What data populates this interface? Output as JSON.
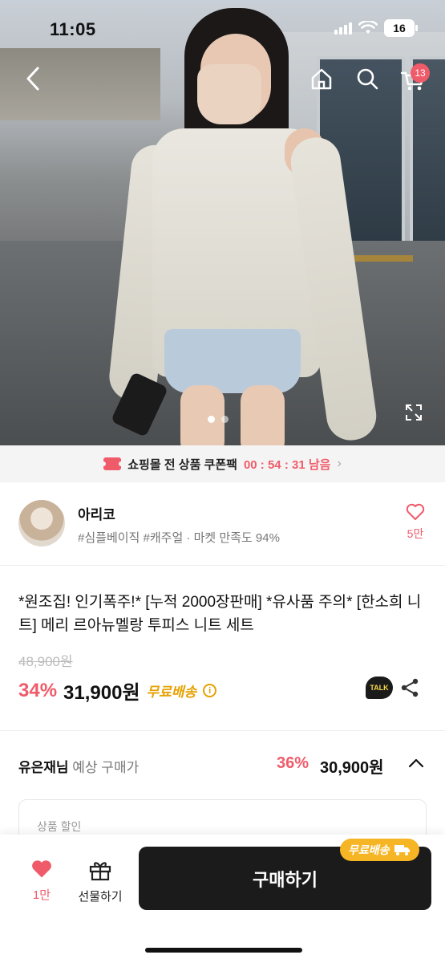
{
  "status_bar": {
    "time": "11:05",
    "battery": "16"
  },
  "nav": {
    "cart_count": "13"
  },
  "coupon": {
    "text": "쇼핑몰 전 상품 쿠폰팩",
    "timer": "00 : 54 : 31 남음",
    "chevron": "›"
  },
  "seller": {
    "name": "아리코",
    "tags": "#심플베이직 #캐주얼 · 마켓 만족도 94%",
    "likes": "5만"
  },
  "product": {
    "title": "*원조집! 인기폭주!* [누적 2000장판매] *유사품 주의* [한소희 니트] 메리 르아뉴멜랑 투피스 니트 세트",
    "original_price": "48,900원",
    "discount": "34%",
    "price": "31,900원",
    "free_shipping": "무료배송",
    "talk": "TALK"
  },
  "expected": {
    "user": "유은재님",
    "label": "예상 구매가",
    "discount": "36%",
    "price": "30,900원"
  },
  "discount_card": {
    "label": "상품 할인"
  },
  "bottom": {
    "likes": "1만",
    "gift": "선물하기",
    "buy": "구매하기",
    "ship_badge": "무료배송"
  },
  "colors": {
    "accent": "#f05b6a",
    "ship": "#f6b524",
    "buy_bg": "#1b1b1b"
  },
  "icons": [
    "back-icon",
    "home-icon",
    "search-icon",
    "cart-icon",
    "expand-icon",
    "coupon-icon",
    "heart-icon",
    "info-icon",
    "talk-icon",
    "share-icon",
    "chevron-up-icon",
    "gift-icon",
    "truck-icon"
  ]
}
